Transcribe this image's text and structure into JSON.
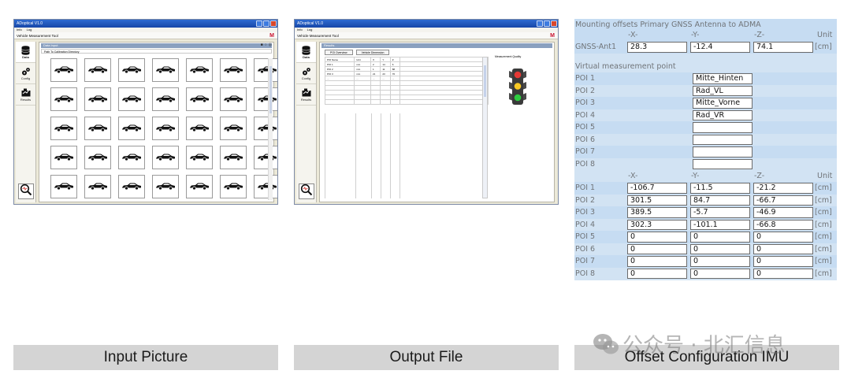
{
  "app": {
    "title": "ADoptical V1.0",
    "menu": [
      "Info",
      "Log"
    ],
    "subtitle": "Vehicle Measurement Tool",
    "logo": "M"
  },
  "sidebar": {
    "items": [
      {
        "label": "Data",
        "icon": "database-icon"
      },
      {
        "label": "Config",
        "icon": "gears-icon"
      },
      {
        "label": "Results",
        "icon": "results-icon"
      }
    ],
    "analysis_icon": "magnifier-icon"
  },
  "data_panel": {
    "title": "Data Input",
    "path": "Path To Calibration Directory",
    "thumbnail_rows": 5,
    "thumbnail_cols": 7,
    "thumbnail_icon": "car-icon"
  },
  "results_panel": {
    "title": "Results",
    "tabs": [
      "POI Overview",
      "Vehicle Dimension"
    ],
    "table_header": [
      "POI Name",
      "Unit",
      "X",
      "Y",
      "Z"
    ],
    "table_rows": [
      [
        "POI 1",
        "mm",
        "2",
        "14",
        "6"
      ],
      [
        "POI 2",
        "mm",
        "1",
        "11",
        "88"
      ],
      [
        "POI 3",
        "mm",
        "21",
        "23",
        "76"
      ],
      [
        "...",
        "...",
        "...",
        "...",
        "..."
      ]
    ],
    "quality_label": "Measurement Quality"
  },
  "offset_config": {
    "title": "Mounting offsets Primary GNSS Antenna to ADMA",
    "columns": [
      "-X-",
      "-Y-",
      "-Z-",
      "Unit"
    ],
    "antenna": {
      "label": "GNSS-Ant1",
      "x": "28.3",
      "y": "-12.4",
      "z": "74.1",
      "unit": "[cm]"
    },
    "virtual_title": "Virtual measurement point",
    "poi_names": [
      {
        "label": "POI 1",
        "name": "Mitte_Hinten"
      },
      {
        "label": "POI 2",
        "name": "Rad_VL"
      },
      {
        "label": "POI 3",
        "name": "Mitte_Vorne"
      },
      {
        "label": "POI 4",
        "name": "Rad_VR"
      },
      {
        "label": "POI 5",
        "name": ""
      },
      {
        "label": "POI 6",
        "name": ""
      },
      {
        "label": "POI 7",
        "name": ""
      },
      {
        "label": "POI 8",
        "name": ""
      }
    ],
    "poi_offsets": [
      {
        "label": "POI 1",
        "x": "-106.7",
        "y": "-11.5",
        "z": "-21.2",
        "unit": "[cm]"
      },
      {
        "label": "POI 2",
        "x": "301.5",
        "y": "84.7",
        "z": "-66.7",
        "unit": "[cm]"
      },
      {
        "label": "POI 3",
        "x": "389.5",
        "y": "-5.7",
        "z": "-46.9",
        "unit": "[cm]"
      },
      {
        "label": "POI 4",
        "x": "302.3",
        "y": "-101.1",
        "z": "-66.8",
        "unit": "[cm]"
      },
      {
        "label": "POI 5",
        "x": "0",
        "y": "0",
        "z": "0",
        "unit": "[cm]"
      },
      {
        "label": "POI 6",
        "x": "0",
        "y": "0",
        "z": "0",
        "unit": "[cm]"
      },
      {
        "label": "POI 7",
        "x": "0",
        "y": "0",
        "z": "0",
        "unit": "[cm]"
      },
      {
        "label": "POI 8",
        "x": "0",
        "y": "0",
        "z": "0",
        "unit": "[cm]"
      }
    ]
  },
  "captions": {
    "left": "Input Picture",
    "middle": "Output File",
    "right": "Offset Configuration IMU"
  },
  "watermark": "公众号 · 北汇信息",
  "colors": {
    "config_background": "#d2e3f3",
    "titlebar": "#1f57c0",
    "caption_bar": "#d4d4d4",
    "traffic_red": "#e53935",
    "traffic_yellow": "#f9c924",
    "traffic_green": "#2ecc40"
  }
}
